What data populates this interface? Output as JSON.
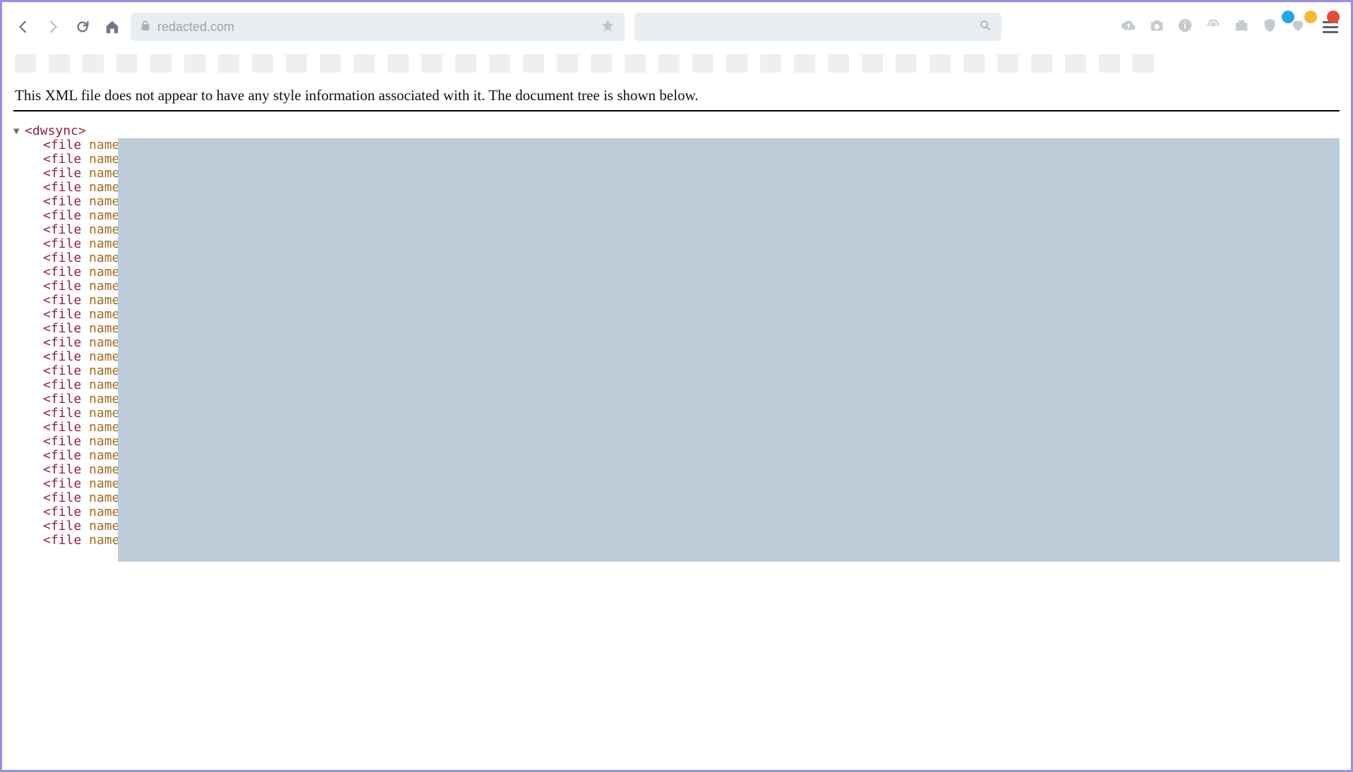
{
  "window": {
    "dots": [
      "blue",
      "yellow",
      "red"
    ]
  },
  "toolbar": {
    "url": "redacted.com",
    "url_placeholder": "",
    "search_placeholder": ""
  },
  "tabstrip": {
    "count": 34
  },
  "content": {
    "notice": "This XML file does not appear to have any style information associated with it. The document tree is shown below.",
    "root_tag": "dwsync",
    "collapse_glyph": "▼",
    "file_tag_prefix": "<file",
    "file_attr": "name",
    "file_attr_eq": "=",
    "file_count": 29
  }
}
